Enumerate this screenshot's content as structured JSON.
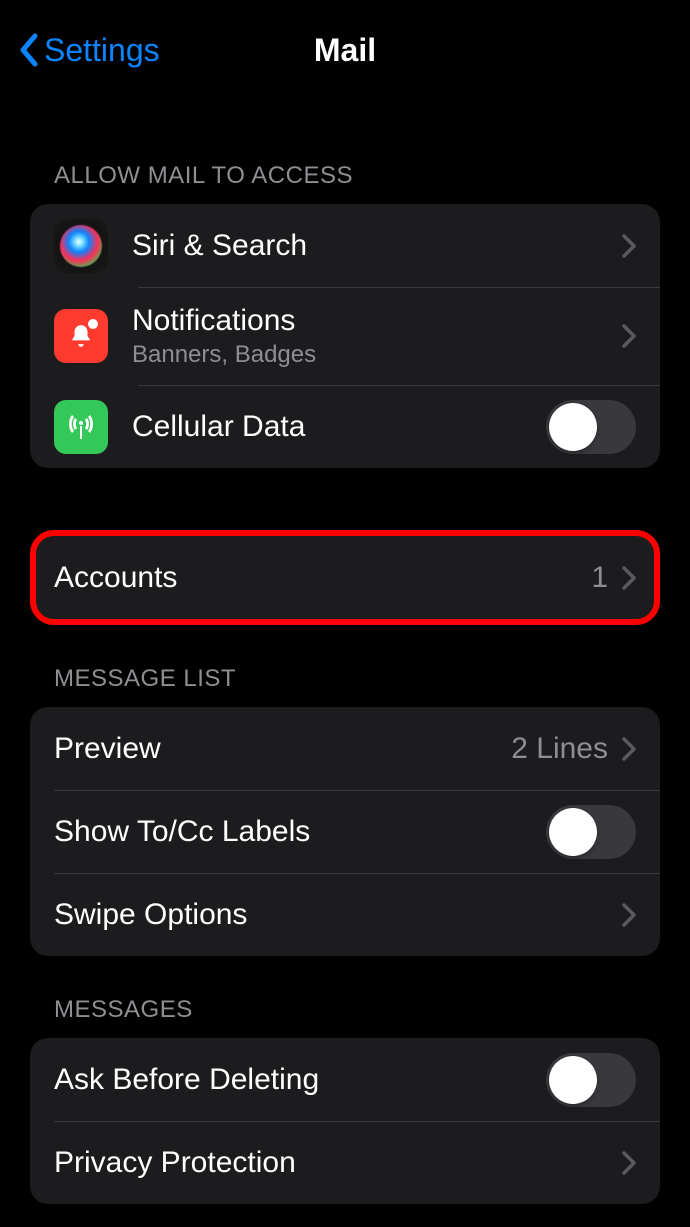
{
  "nav": {
    "back_label": "Settings",
    "title": "Mail"
  },
  "sections": {
    "access": {
      "header": "Allow Mail to Access",
      "siri_label": "Siri & Search",
      "notifications_label": "Notifications",
      "notifications_sub": "Banners, Badges",
      "cellular_label": "Cellular Data"
    },
    "accounts": {
      "label": "Accounts",
      "value": "1"
    },
    "message_list": {
      "header": "Message List",
      "preview_label": "Preview",
      "preview_value": "2 Lines",
      "show_to_cc_label": "Show To/Cc Labels",
      "swipe_label": "Swipe Options"
    },
    "messages": {
      "header": "Messages",
      "ask_delete_label": "Ask Before Deleting",
      "privacy_label": "Privacy Protection"
    }
  },
  "toggles": {
    "cellular_data": false,
    "show_to_cc": false,
    "ask_before_deleting": false
  }
}
